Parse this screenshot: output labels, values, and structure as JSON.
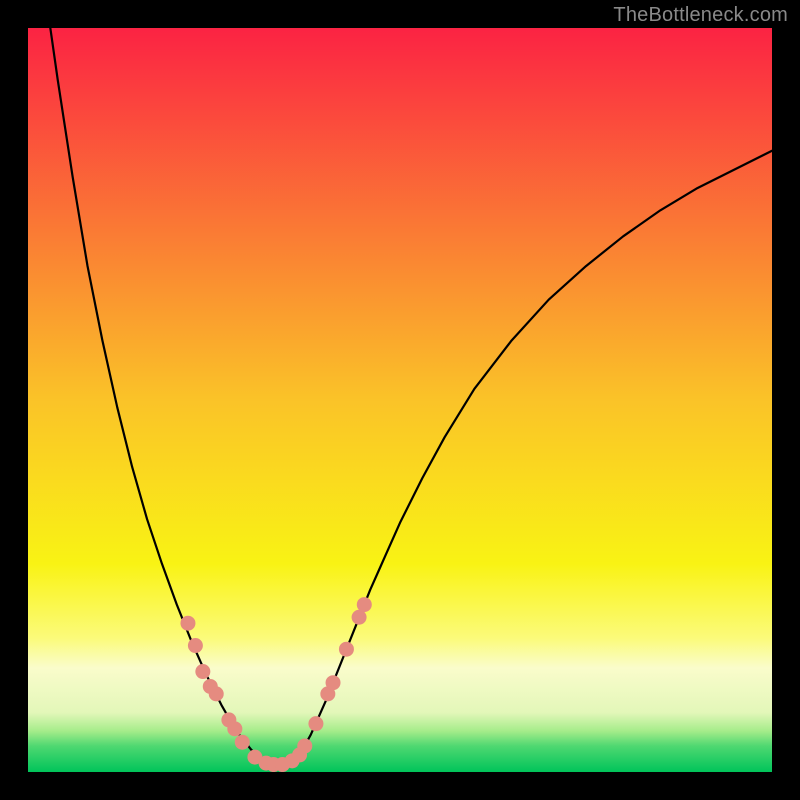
{
  "watermark": "TheBottleneck.com",
  "colors": {
    "black": "#000000",
    "curve": "#000000",
    "marker_fill": "#e58b80",
    "marker_stroke": "#c45a4e",
    "gradient_stops": [
      {
        "offset": 0.0,
        "color": "#fb2343"
      },
      {
        "offset": 0.5,
        "color": "#fac328"
      },
      {
        "offset": 0.72,
        "color": "#f9f314"
      },
      {
        "offset": 0.82,
        "color": "#fbfb7a"
      },
      {
        "offset": 0.86,
        "color": "#fafccb"
      },
      {
        "offset": 0.92,
        "color": "#e3f7b9"
      },
      {
        "offset": 0.945,
        "color": "#a5ec8a"
      },
      {
        "offset": 0.965,
        "color": "#4fd871"
      },
      {
        "offset": 1.0,
        "color": "#00c45a"
      }
    ]
  },
  "chart_data": {
    "type": "line",
    "title": "",
    "xlabel": "",
    "ylabel": "",
    "xlim": [
      0,
      100
    ],
    "ylim": [
      0,
      100
    ],
    "curve": [
      {
        "x": 3.0,
        "y": 100.0
      },
      {
        "x": 4.0,
        "y": 93.0
      },
      {
        "x": 6.0,
        "y": 80.0
      },
      {
        "x": 8.0,
        "y": 68.0
      },
      {
        "x": 10.0,
        "y": 58.0
      },
      {
        "x": 12.0,
        "y": 49.0
      },
      {
        "x": 14.0,
        "y": 41.0
      },
      {
        "x": 16.0,
        "y": 34.0
      },
      {
        "x": 18.0,
        "y": 28.0
      },
      {
        "x": 20.0,
        "y": 22.5
      },
      {
        "x": 22.0,
        "y": 17.5
      },
      {
        "x": 24.0,
        "y": 13.0
      },
      {
        "x": 26.0,
        "y": 9.0
      },
      {
        "x": 28.0,
        "y": 5.5
      },
      {
        "x": 30.0,
        "y": 3.0
      },
      {
        "x": 31.0,
        "y": 2.0
      },
      {
        "x": 32.0,
        "y": 1.3
      },
      {
        "x": 33.0,
        "y": 1.0
      },
      {
        "x": 34.0,
        "y": 1.0
      },
      {
        "x": 35.0,
        "y": 1.2
      },
      {
        "x": 36.0,
        "y": 2.0
      },
      {
        "x": 37.0,
        "y": 3.2
      },
      {
        "x": 38.0,
        "y": 5.0
      },
      {
        "x": 40.0,
        "y": 9.5
      },
      {
        "x": 42.0,
        "y": 14.5
      },
      {
        "x": 44.0,
        "y": 19.5
      },
      {
        "x": 46.0,
        "y": 24.5
      },
      {
        "x": 48.0,
        "y": 29.0
      },
      {
        "x": 50.0,
        "y": 33.5
      },
      {
        "x": 53.0,
        "y": 39.5
      },
      {
        "x": 56.0,
        "y": 45.0
      },
      {
        "x": 60.0,
        "y": 51.5
      },
      {
        "x": 65.0,
        "y": 58.0
      },
      {
        "x": 70.0,
        "y": 63.5
      },
      {
        "x": 75.0,
        "y": 68.0
      },
      {
        "x": 80.0,
        "y": 72.0
      },
      {
        "x": 85.0,
        "y": 75.5
      },
      {
        "x": 90.0,
        "y": 78.5
      },
      {
        "x": 95.0,
        "y": 81.0
      },
      {
        "x": 100.0,
        "y": 83.5
      }
    ],
    "markers": [
      {
        "x": 21.5,
        "y": 20.0
      },
      {
        "x": 22.5,
        "y": 17.0
      },
      {
        "x": 23.5,
        "y": 13.5
      },
      {
        "x": 24.5,
        "y": 11.5
      },
      {
        "x": 25.3,
        "y": 10.5
      },
      {
        "x": 27.0,
        "y": 7.0
      },
      {
        "x": 27.8,
        "y": 5.8
      },
      {
        "x": 28.8,
        "y": 4.0
      },
      {
        "x": 30.5,
        "y": 2.0
      },
      {
        "x": 32.0,
        "y": 1.2
      },
      {
        "x": 33.0,
        "y": 1.0
      },
      {
        "x": 34.2,
        "y": 1.0
      },
      {
        "x": 35.5,
        "y": 1.5
      },
      {
        "x": 36.5,
        "y": 2.3
      },
      {
        "x": 37.2,
        "y": 3.5
      },
      {
        "x": 38.7,
        "y": 6.5
      },
      {
        "x": 40.3,
        "y": 10.5
      },
      {
        "x": 41.0,
        "y": 12.0
      },
      {
        "x": 42.8,
        "y": 16.5
      },
      {
        "x": 44.5,
        "y": 20.8
      },
      {
        "x": 45.2,
        "y": 22.5
      }
    ]
  }
}
